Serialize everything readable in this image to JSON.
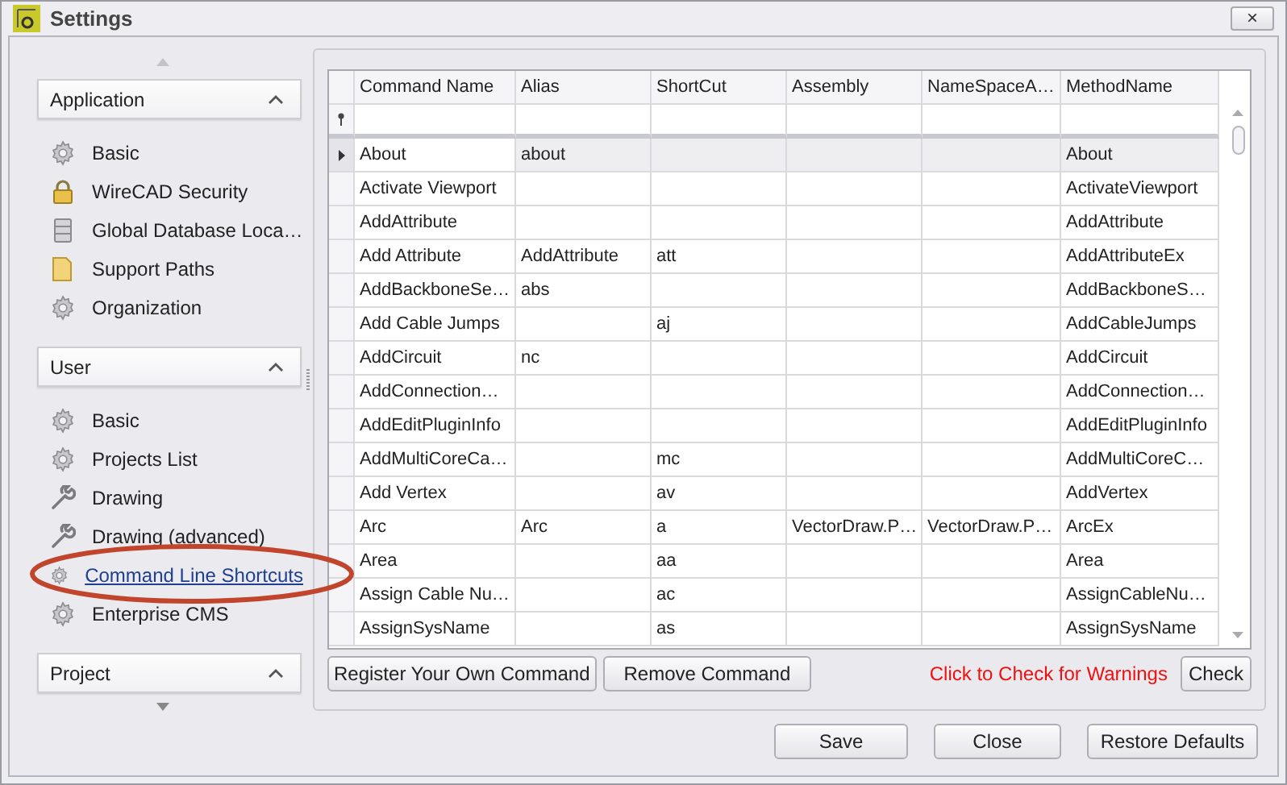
{
  "window": {
    "title": "Settings",
    "close_label": "×"
  },
  "sidebar": {
    "groups": [
      {
        "title": "Application",
        "expanded": true,
        "items": [
          {
            "label": "Basic",
            "selected": false
          },
          {
            "label": "WireCAD Security",
            "selected": false
          },
          {
            "label": "Global Database Loca…",
            "selected": false
          },
          {
            "label": "Support Paths",
            "selected": false
          },
          {
            "label": "Organization",
            "selected": false
          }
        ]
      },
      {
        "title": "User",
        "expanded": true,
        "items": [
          {
            "label": "Basic",
            "selected": false
          },
          {
            "label": "Projects List",
            "selected": false
          },
          {
            "label": "Drawing",
            "selected": false
          },
          {
            "label": "Drawing (advanced)",
            "selected": false
          },
          {
            "label": "Command Line Shortcuts",
            "selected": true
          },
          {
            "label": "Enterprise CMS",
            "selected": false
          }
        ]
      },
      {
        "title": "Project",
        "expanded": true
      }
    ]
  },
  "table": {
    "columns": [
      "Command Name",
      "Alias",
      "ShortCut",
      "Assembly",
      "NameSpaceA…",
      "MethodName"
    ],
    "rows": [
      {
        "current": true,
        "cells": [
          "About",
          "about",
          "",
          "",
          "",
          "About"
        ]
      },
      {
        "current": false,
        "cells": [
          "Activate Viewport",
          "",
          "",
          "",
          "",
          "ActivateViewport"
        ]
      },
      {
        "current": false,
        "cells": [
          "AddAttribute",
          "",
          "",
          "",
          "",
          "AddAttribute"
        ]
      },
      {
        "current": false,
        "cells": [
          "Add Attribute",
          "AddAttribute",
          "att",
          "",
          "",
          "AddAttributeEx"
        ]
      },
      {
        "current": false,
        "cells": [
          "AddBackboneSe…",
          "abs",
          "",
          "",
          "",
          "AddBackboneS…"
        ]
      },
      {
        "current": false,
        "cells": [
          "Add Cable Jumps",
          "",
          "aj",
          "",
          "",
          "AddCableJumps"
        ]
      },
      {
        "current": false,
        "cells": [
          "AddCircuit",
          "nc",
          "",
          "",
          "",
          "AddCircuit"
        ]
      },
      {
        "current": false,
        "cells": [
          "AddConnection…",
          "",
          "",
          "",
          "",
          "AddConnection…"
        ]
      },
      {
        "current": false,
        "cells": [
          "AddEditPluginInfo",
          "",
          "",
          "",
          "",
          "AddEditPluginInfo"
        ]
      },
      {
        "current": false,
        "cells": [
          "AddMultiCoreCa…",
          "",
          "mc",
          "",
          "",
          "AddMultiCoreC…"
        ]
      },
      {
        "current": false,
        "cells": [
          "Add Vertex",
          "",
          "av",
          "",
          "",
          "AddVertex"
        ]
      },
      {
        "current": false,
        "cells": [
          "Arc",
          "Arc",
          "a",
          "VectorDraw.P…",
          "VectorDraw.P…",
          "ArcEx"
        ]
      },
      {
        "current": false,
        "cells": [
          "Area",
          "",
          "aa",
          "",
          "",
          "Area"
        ]
      },
      {
        "current": false,
        "cells": [
          "Assign Cable Nu…",
          "",
          "ac",
          "",
          "",
          "AssignCableNu…"
        ]
      },
      {
        "current": false,
        "cells": [
          "AssignSysName",
          "",
          "as",
          "",
          "",
          "AssignSysName"
        ]
      }
    ]
  },
  "grid_actions": {
    "buttons": [
      "Register Your Own Command",
      "Remove Command"
    ],
    "warning": "Click to Check for Warnings",
    "check_button": "Check"
  },
  "footer": {
    "buttons": [
      "Save",
      "Close",
      "Restore Defaults"
    ]
  }
}
